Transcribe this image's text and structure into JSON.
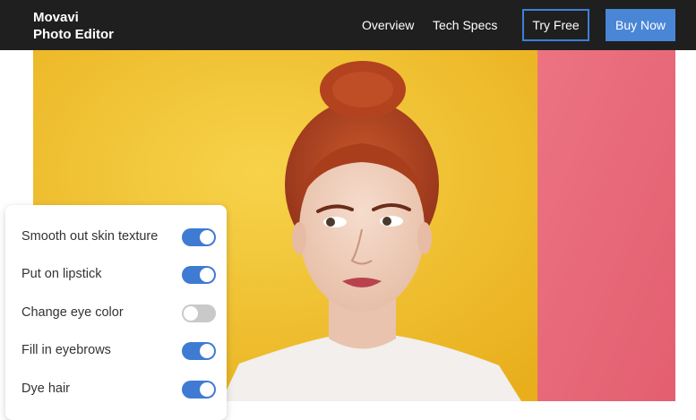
{
  "header": {
    "brand_line1": "Movavi",
    "brand_line2": "Photo Editor",
    "nav": [
      "Overview",
      "Tech Specs"
    ],
    "try_free_label": "Try Free",
    "buy_now_label": "Buy Now"
  },
  "colors": {
    "accent": "#4a86d6",
    "wall_yellow": "#f1c12c",
    "wall_pink": "#e96b7a",
    "hair": "#b8441e"
  },
  "options": [
    {
      "label": "Smooth out skin texture",
      "enabled": true
    },
    {
      "label": "Put on lipstick",
      "enabled": true
    },
    {
      "label": "Change eye color",
      "enabled": false
    },
    {
      "label": "Fill in eyebrows",
      "enabled": true
    },
    {
      "label": "Dye hair",
      "enabled": true
    }
  ]
}
